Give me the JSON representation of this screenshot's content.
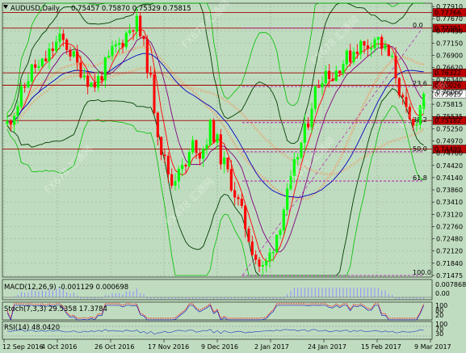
{
  "header": {
    "symbol_text": "AUDUSD,Daily",
    "ohlc_text": "0.75457 0.75870 0.75329 0.75815"
  },
  "price_axis": {
    "ticks": [
      "0.77910",
      "0.77670",
      "0.77430",
      "0.77150",
      "0.76900",
      "0.76620",
      "0.76340",
      "0.76060",
      "0.75815",
      "0.75535",
      "0.75250",
      "0.74970",
      "0.74700",
      "0.74420",
      "0.74140",
      "0.73860",
      "0.73410",
      "0.73120",
      "0.72760",
      "0.72480",
      "0.72120",
      "0.71840",
      "0.71475"
    ],
    "highlight_labels": [
      {
        "text": "0.77766",
        "color": "#c00000"
      },
      {
        "text": "0.77391",
        "color": "#c00000"
      },
      {
        "text": "0.76322",
        "color": "#c00000"
      },
      {
        "text": "0.76026",
        "color": "#c00000"
      },
      {
        "text": "0.75815",
        "color": "#000000"
      },
      {
        "text": "0.75182",
        "color": "#c00000"
      },
      {
        "text": "0.74499",
        "color": "#c00000"
      }
    ]
  },
  "fib_labels": [
    "0.0",
    "23.6",
    "38.2",
    "50.0",
    "61.8",
    "100.0"
  ],
  "indicators": {
    "macd": {
      "label": "MACD(12,26,9) -0.001129 0.000698",
      "axis": [
        "0.007868",
        "0.00"
      ]
    },
    "stoch": {
      "label": "Stoch(7,3,3) 29.5358 17.3784",
      "axis": [
        "100",
        "80",
        "20"
      ]
    },
    "rsi": {
      "label": "RSI(14) 48.0420",
      "axis": [
        "100",
        "70",
        "30"
      ]
    }
  },
  "time_axis": [
    "12 Sep 2016",
    "4 Oct 2016",
    "26 Oct 2016",
    "17 Nov 2016",
    "9 Dec 2016",
    "2 Jan 2017",
    "24 Jan 2017",
    "15 Feb 2017",
    "9 Mar 2017"
  ],
  "watermark": "FX678 汇通网",
  "colors": {
    "background": "#c0dcc0",
    "grid": "#8aa08a",
    "bull": "#00ff00",
    "bear": "#ff0000",
    "level_line": "#a00000",
    "fib_line": "#b000b0",
    "ma_fast": "#ff0000",
    "ma_mid": "#800080",
    "ma_slow": "#0000c0",
    "bollinger": "#004000",
    "rsi_line": "#00c000"
  },
  "chart_data": {
    "type": "candlestick",
    "title": "AUDUSD,Daily",
    "x_start": "12 Sep 2016",
    "x_end": "9 Mar 2017",
    "ylim": [
      0.71475,
      0.7791
    ],
    "last_bar": {
      "open": 0.75457,
      "high": 0.7587,
      "low": 0.75329,
      "close": 0.75815
    },
    "path_points": [
      0.751,
      0.7535,
      0.756,
      0.759,
      0.7625,
      0.765,
      0.764,
      0.766,
      0.768,
      0.77,
      0.771,
      0.77,
      0.768,
      0.765,
      0.764,
      0.762,
      0.76,
      0.7615,
      0.764,
      0.766,
      0.769,
      0.77,
      0.772,
      0.774,
      0.776,
      0.772,
      0.767,
      0.76,
      0.751,
      0.744,
      0.74,
      0.736,
      0.742,
      0.739,
      0.743,
      0.747,
      0.744,
      0.746,
      0.75,
      0.748,
      0.743,
      0.74,
      0.737,
      0.733,
      0.729,
      0.725,
      0.721,
      0.7175,
      0.716,
      0.719,
      0.723,
      0.727,
      0.732,
      0.736,
      0.742,
      0.746,
      0.75,
      0.756,
      0.76,
      0.763,
      0.764,
      0.762,
      0.765,
      0.766,
      0.767,
      0.769,
      0.77,
      0.769,
      0.771,
      0.772,
      0.77,
      0.768,
      0.766,
      0.762,
      0.756,
      0.752,
      0.75,
      0.754,
      0.7581
    ]
  }
}
